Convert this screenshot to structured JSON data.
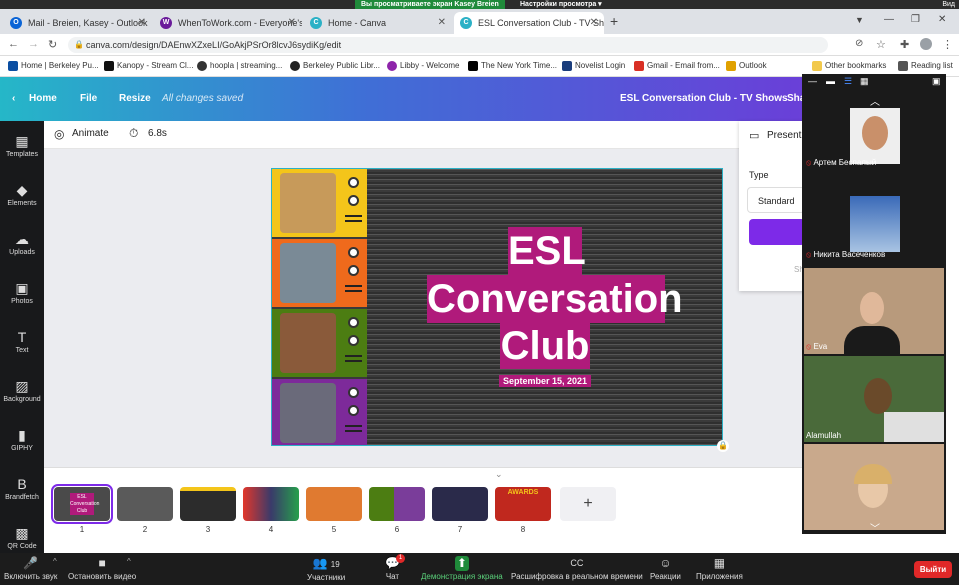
{
  "zoom_top": {
    "share_banner": "Вы просматриваете экран Kasey Breien",
    "view_options": "Настройки просмотра ▾",
    "view_label": "Вид"
  },
  "tabs": [
    {
      "label": "Mail - Breien, Kasey - Outlook",
      "icon_color": "#0a64d6",
      "icon": "O"
    },
    {
      "label": "WhenToWork.com - Everyone's S",
      "icon_color": "#6a1b9a",
      "icon": "W"
    },
    {
      "label": "Home - Canva",
      "icon_color": "#2bb1c6",
      "icon": "C"
    },
    {
      "label": "ESL Conversation Club - TV Sho",
      "icon_color": "#2bb1c6",
      "icon": "C"
    }
  ],
  "address": {
    "url": "canva.com/design/DAEnwXZxeLI/GoAkjPSrOr8lcvJ6sydiKg/edit"
  },
  "bookmarks": [
    {
      "label": "Home | Berkeley Pu...",
      "color": "#0b4ea2"
    },
    {
      "label": "Kanopy - Stream Cl...",
      "color": "#111111"
    },
    {
      "label": "hoopla | streaming...",
      "color": "#333333"
    },
    {
      "label": "Berkeley Public Libr...",
      "color": "#222222"
    },
    {
      "label": "Libby - Welcome",
      "color": "#8e24aa"
    },
    {
      "label": "The New York Time...",
      "color": "#000000"
    },
    {
      "label": "Novelist Login",
      "color": "#1a3d7c"
    },
    {
      "label": "Gmail - Email from...",
      "color": "#d93025"
    },
    {
      "label": "Outlook",
      "color": "#e0a100"
    },
    {
      "label": "Other bookmarks",
      "color": "#f2c94c"
    },
    {
      "label": "Reading list",
      "color": "#555555"
    }
  ],
  "canva_header": {
    "home": "Home",
    "file": "File",
    "resize": "Resize",
    "status": "All changes saved",
    "doc_title": "ESL Conversation Club - TV Shows",
    "share": "Sha"
  },
  "sidebar": [
    {
      "label": "Templates",
      "icon": "▦"
    },
    {
      "label": "Elements",
      "icon": "◆"
    },
    {
      "label": "Uploads",
      "icon": "☁"
    },
    {
      "label": "Photos",
      "icon": "▣"
    },
    {
      "label": "Text",
      "icon": "T"
    },
    {
      "label": "Background",
      "icon": "▨"
    },
    {
      "label": "GIPHY",
      "icon": "▮"
    },
    {
      "label": "Brandfetch",
      "icon": "B"
    },
    {
      "label": "QR Code",
      "icon": "▩"
    }
  ],
  "toolbar": {
    "animate": "Animate",
    "duration": "6.8s"
  },
  "slide": {
    "line1": "ESL",
    "line2": "Conversation",
    "line3": "Club",
    "date": "September 15, 2021",
    "strips": [
      {
        "color": "#f4c51a"
      },
      {
        "color": "#ef6a1c"
      },
      {
        "color": "#4c7d12"
      },
      {
        "color": "#7d2a9a"
      }
    ]
  },
  "present_panel": {
    "title": "Present",
    "type_label": "Type",
    "type_value": "Standard",
    "sh": "Sh"
  },
  "thumbnails": [
    {
      "num": "1",
      "title": "ESL Conversation Club",
      "bg": "#4a4a4a"
    },
    {
      "num": "2",
      "bg": "#5a5a5a"
    },
    {
      "num": "3",
      "bg": "#2c2c2c"
    },
    {
      "num": "4",
      "bg": "#3a3a6a"
    },
    {
      "num": "5",
      "bg": "#e07a30"
    },
    {
      "num": "6",
      "bg": "#7a3d9a"
    },
    {
      "num": "7",
      "bg": "#2a2a4a"
    },
    {
      "num": "8",
      "title": "AWARDS",
      "bg": "#c0281e"
    }
  ],
  "zoom_participants": [
    {
      "name": "Артем Беспалый",
      "bg": "#eeeeee"
    },
    {
      "name": "Никита Васеченков",
      "bg": "#6a93c9"
    },
    {
      "name": "Eva",
      "bg": "#b89a7c"
    },
    {
      "name": "Alamullah",
      "bg": "#4a6a3a"
    },
    {
      "name": "",
      "bg": "#c9a98c"
    }
  ],
  "zoom_bottom": [
    {
      "label": "Включить звук",
      "icon": "🎤"
    },
    {
      "label": "Остановить видео",
      "icon": "■"
    },
    {
      "label": "Участники",
      "icon": "👥",
      "count": "19"
    },
    {
      "label": "Чат",
      "icon": "💬",
      "badge": "1"
    },
    {
      "label": "Демонстрация экрана",
      "icon": "⬆"
    },
    {
      "label": "Расшифровка в реальном времени",
      "icon": "CC"
    },
    {
      "label": "Реакции",
      "icon": "☺"
    },
    {
      "label": "Приложения",
      "icon": "▦"
    }
  ],
  "leave": "Выйти",
  "colors": {
    "canva_purple": "#7d2ae8",
    "magenta": "#b01a7b",
    "zoom_green": "#1f8a3a",
    "leave_red": "#e02828"
  }
}
